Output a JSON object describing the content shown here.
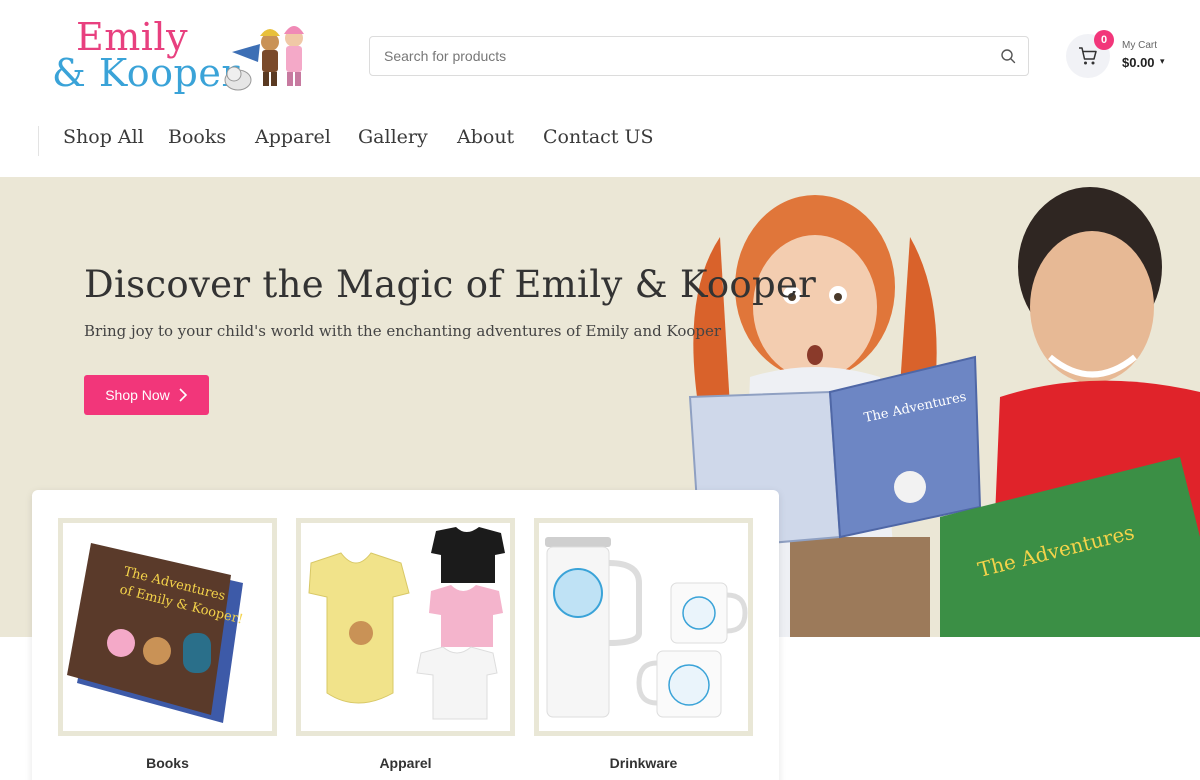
{
  "header": {
    "logo_line1": "Emily",
    "logo_line2": "& Kooper",
    "search_placeholder": "Search for products",
    "cart_count": "0",
    "cart_label": "My Cart",
    "cart_total": "$0.00"
  },
  "nav": {
    "items": [
      "Shop All",
      "Books",
      "Apparel",
      "Gallery",
      "About",
      "Contact US"
    ]
  },
  "hero": {
    "title": "Discover the Magic of Emily & Kooper",
    "subtitle": "Bring joy to your child's world with the enchanting adventures of Emily and Kooper",
    "button_label": "Shop Now"
  },
  "categories": [
    {
      "label": "Books"
    },
    {
      "label": "Apparel"
    },
    {
      "label": "Drinkware"
    }
  ],
  "colors": {
    "accent": "#f2367a",
    "hero_bg": "#ebe7d6",
    "logo_pink": "#e8407f",
    "logo_blue": "#3aa3d8",
    "frame": "#e9e7d6"
  },
  "icons": [
    "search-icon",
    "cart-icon",
    "chevron-right-icon",
    "caret-down-icon"
  ]
}
